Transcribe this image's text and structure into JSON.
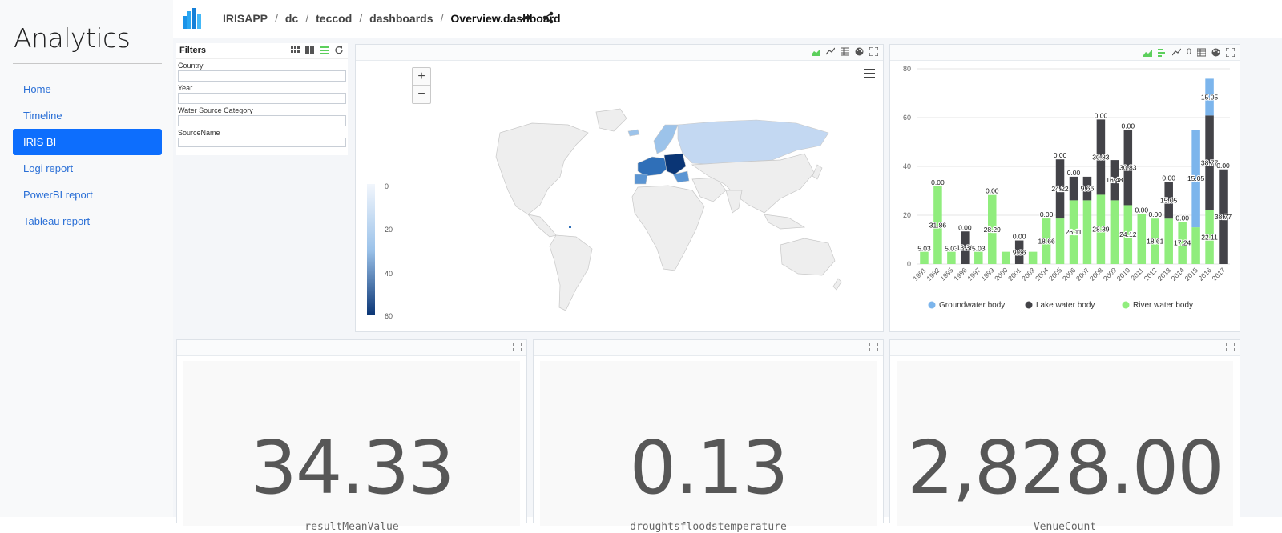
{
  "sidebar": {
    "title": "Analytics",
    "items": [
      {
        "label": "Home",
        "active": false
      },
      {
        "label": "Timeline",
        "active": false
      },
      {
        "label": "IRIS BI",
        "active": true
      },
      {
        "label": "Logi report",
        "active": false
      },
      {
        "label": "PowerBI report",
        "active": false
      },
      {
        "label": "Tableau report",
        "active": false
      }
    ]
  },
  "breadcrumb": [
    "IRISAPP",
    "dc",
    "teccod",
    "dashboards",
    "Overview.dashboard"
  ],
  "filters": {
    "title": "Filters",
    "fields": [
      {
        "label": "Country",
        "value": ""
      },
      {
        "label": "Year",
        "value": ""
      },
      {
        "label": "Water Source Category",
        "value": ""
      },
      {
        "label": "SourceName",
        "value": ""
      }
    ]
  },
  "map": {
    "zoom_in": "+",
    "zoom_out": "−",
    "legend_ticks": [
      "0",
      "20",
      "40",
      "60"
    ],
    "colors": {
      "low": "#f2f6fc",
      "mid": "#9cc3ea",
      "high": "#0a3575",
      "land": "#eeeeee",
      "border": "#c8c8c8"
    }
  },
  "chart_toolbar_count": "0",
  "chart_data": {
    "type": "bar",
    "stacked": true,
    "categories": [
      "1991",
      "1992",
      "1995",
      "1996",
      "1997",
      "1999",
      "2000",
      "2001",
      "2003",
      "2004",
      "2005",
      "2006",
      "2007",
      "2008",
      "2009",
      "2010",
      "2011",
      "2012",
      "2013",
      "2014",
      "2015",
      "2016",
      "2017"
    ],
    "ylim": [
      0,
      80
    ],
    "yticks": [
      0,
      20,
      40,
      60,
      80
    ],
    "grid": true,
    "legend_position": "bottom",
    "series": [
      {
        "name": "River water body",
        "color": "#90ed7d",
        "values": [
          5.03,
          31.86,
          5.03,
          0,
          5.03,
          28.29,
          5.03,
          0,
          5.03,
          18.66,
          18.66,
          26.11,
          26.11,
          28.39,
          26.11,
          24.12,
          20.5,
          18.61,
          18.61,
          17.24,
          15.05,
          22.11,
          0
        ],
        "labels": [
          "5.03",
          "31.86",
          "5.03",
          "",
          "5.03",
          "28.29",
          "",
          "",
          "",
          "18.66",
          "",
          "26.11",
          "",
          "28.39",
          "",
          "24.12",
          "",
          "18.61",
          "",
          "17.24",
          "",
          "22.11",
          ""
        ]
      },
      {
        "name": "Lake water body",
        "color": "#434348",
        "values": [
          0,
          0,
          0,
          13.36,
          0,
          0,
          0,
          9.66,
          0,
          0,
          24.22,
          9.66,
          9.66,
          30.83,
          16.48,
          30.83,
          0,
          0,
          15.05,
          0,
          0,
          38.77,
          38.77
        ],
        "labels": [
          "",
          "",
          "",
          "13.36",
          "",
          "",
          "",
          "9.66",
          "",
          "",
          "24.22",
          "",
          "9.66",
          "30.83",
          "16.48",
          "30.83",
          "",
          "",
          "15.05",
          "",
          "",
          "38.77",
          "38.77"
        ]
      },
      {
        "name": "Groundwater body",
        "color": "#7cb5ec",
        "values": [
          0,
          0,
          0,
          0,
          0,
          0,
          0,
          0,
          0,
          0,
          0,
          0,
          0,
          0,
          0,
          0,
          0,
          0,
          0,
          0,
          40,
          15.05,
          0
        ],
        "labels": [
          "",
          "",
          "",
          "",
          "",
          "",
          "",
          "",
          "",
          "",
          "",
          "",
          "",
          "",
          "",
          "",
          "",
          "",
          "",
          "",
          "15.05",
          "15.05",
          ""
        ]
      }
    ],
    "top_labels": [
      "",
      "0.00",
      "",
      "0.00",
      "",
      "0.00",
      "",
      "0.00",
      "",
      "0.00",
      "0.00",
      "0.00",
      "",
      "0.00",
      "",
      "0.00",
      "0.00",
      "0.00",
      "0.00",
      "0.00",
      "",
      "",
      "0.00"
    ]
  },
  "kpis": [
    {
      "value": "34.33",
      "label": "resultMeanValue"
    },
    {
      "value": "0.13",
      "label": "droughtsfloodstemperature"
    },
    {
      "value": "2,828.00",
      "label": "VenueCount"
    }
  ]
}
